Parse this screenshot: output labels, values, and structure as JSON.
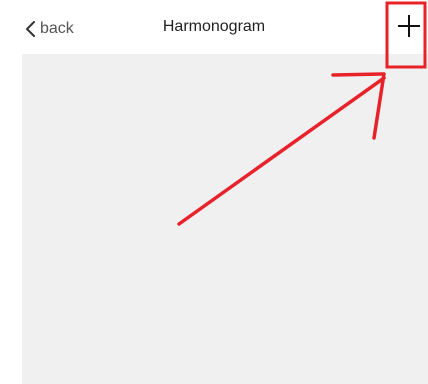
{
  "navbar": {
    "back_label": "back",
    "title": "Harmonogram",
    "add_icon": "plus-icon",
    "back_icon": "chevron-left-icon"
  },
  "colors": {
    "content_bg": "#f0f0f0",
    "annotation": "#e8222a"
  }
}
